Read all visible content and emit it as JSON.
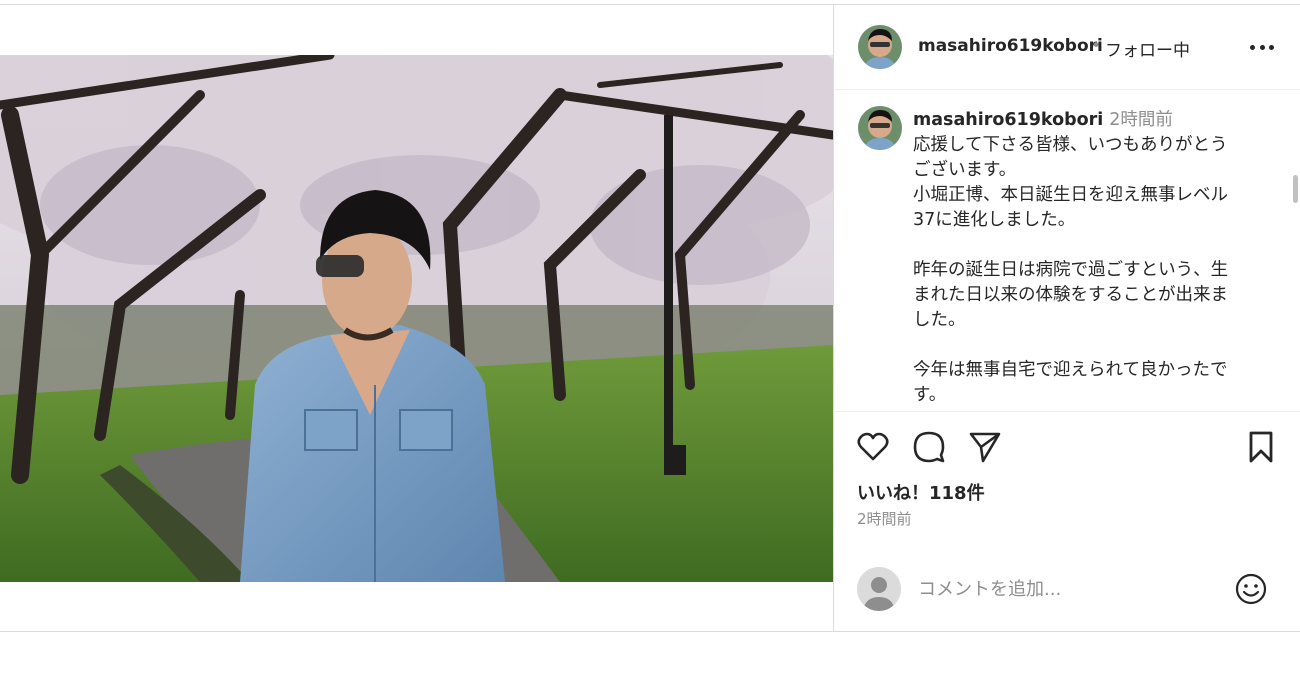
{
  "post": {
    "username": "masahiro619kobori",
    "separator": "•",
    "follow_status": "フォロー中",
    "more_icon": "more-horizontal-icon"
  },
  "caption": {
    "username": "masahiro619kobori",
    "time": "2時間前",
    "lines": [
      "応援して下さる皆様、いつもありがとう",
      "ございます。",
      "小堀正博、本日誕生日を迎え無事レベル",
      "37に進化しました。",
      "",
      "昨年の誕生日は病院で過ごすという、生",
      "まれた日以来の体験をすることが出来ま",
      "した。",
      "",
      "今年は無事自宅で迎えられて良かったで",
      "す。"
    ]
  },
  "actions": {
    "icons": [
      "heart-icon",
      "comment-icon",
      "share-icon",
      "bookmark-icon"
    ],
    "likes": "いいね！118件",
    "posted_time": "2時間前"
  },
  "comment": {
    "placeholder": "コメントを追加...",
    "emoji_icon": "emoji-icon"
  },
  "colors": {
    "text": "#262626",
    "secondary": "#8e8e8e",
    "border": "#dbdbdb"
  }
}
